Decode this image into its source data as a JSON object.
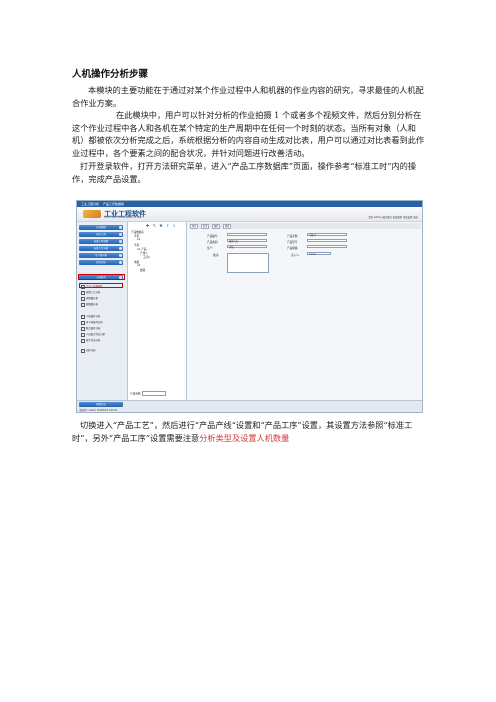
{
  "doc": {
    "title": "人机操作分析步骤",
    "paragraphs": [
      "本模块的主要功能在于通过对某个作业过程中人和机器的作业内容的研究，寻求最佳的人机配合作业方案。",
      "在此模块中，用户可以针对分析的作业拍摄 1 个或者多个视频文件，然后分别分析在这个作业过程中各人和各机在某个特定的生产周期中在任何一个时刻的状态。当所有对象（人和机）都被依次分析完成之后，系统根据分析的内容自动生成对比表，用户可以通过对比表看到此作业过程中，各个要素之间的配合状况，并针对问题进行改善活动。",
      "打开登录软件，打开方法研究菜单，进入“产品工序数据库”页面，操作参考“标准工时”内的操作，完成产品设置。"
    ],
    "last_paragraph_plain": "切换进入“产品工艺”，然后进行“产品产线“设置和“产品工序”设置，其设置方法参照“标准工时”，另外“产品工序”设置需要注意",
    "last_paragraph_red": "分析类型及设置人机数量"
  },
  "screenshot": {
    "tabs": [
      "工业工程分析",
      "产品工序数据库"
    ],
    "brand": "工业工程软件",
    "brand_sub": "INDUSTRIAL ENGINEERING SOFTWARE",
    "top_links": "您好 admin  返回首页  修改密码  系统设置  退出",
    "side_buttons": [
      "企业管理",
      "研究工具",
      "标准工时管理",
      "标准工时分析",
      "生产线平衡",
      "动作分析",
      "方法研究"
    ],
    "side_menu": [
      {
        "label": "产品工序数据库",
        "highlight": true
      },
      {
        "label": "流程工艺分析",
        "highlight": false
      },
      {
        "label": "流程图分析",
        "highlight": false
      },
      {
        "label": "线路图分析",
        "highlight": false
      },
      {
        "label": "人机操作分析",
        "highlight": false
      },
      {
        "label": "多人机操作分析",
        "highlight": false
      },
      {
        "label": "联合操作分析",
        "highlight": false
      },
      {
        "label": "人员配合作业分析",
        "highlight": false
      },
      {
        "label": "双手作业分析",
        "highlight": false
      },
      {
        "label": "动作分析",
        "highlight": false
      }
    ],
    "help_label": "帮助信息",
    "tree_tools": "✚ ✎ ✖ ⇧ ⇩",
    "tree_items": [
      "产品数据库",
      "手机",
      "A1",
      "手机",
      "A1 产品",
      "产线1",
      "工序A",
      "电视",
      "A2",
      "线路"
    ],
    "tree_footer_label": "产品名称:",
    "form_toolbar": [
      "保存",
      "取消",
      "删除",
      "刷新"
    ],
    "fields": {
      "product_code_label": "产品编号:",
      "product_name_label": "产品名称:",
      "product_name_value": "手机A1",
      "category_label": "产品类别:",
      "category_value": "通讯产品",
      "model_label": "产品型号:",
      "line_label": "生产:",
      "line_value": "手机",
      "unit_label": "产品规格:",
      "remark_label": "备注:",
      "operator_label": "录入人:",
      "operator_value": "admin"
    },
    "status_text": "当前用户: admin    2014/5/18  9:45:26"
  }
}
